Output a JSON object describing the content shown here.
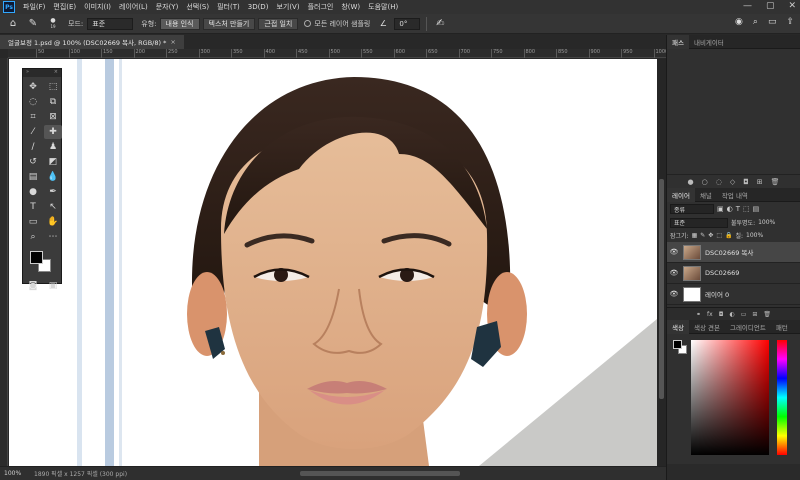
{
  "menubar": {
    "logo": "Ps",
    "items": [
      "파일(F)",
      "편집(E)",
      "이미지(I)",
      "레이어(L)",
      "문자(Y)",
      "선택(S)",
      "필터(T)",
      "3D(D)",
      "보기(V)",
      "플러그인",
      "창(W)",
      "도움말(H)"
    ],
    "window_controls": [
      "—",
      "▢",
      "✕"
    ]
  },
  "options": {
    "brush_size": "19",
    "mode_label": "모드:",
    "mode_value": "표준",
    "type_label": "유형:",
    "type_buttons": [
      "내용 인식",
      "텍스처 만들기",
      "근접 일치"
    ],
    "sample_all_layers": "모든 레이어 샘플링",
    "angle": "0°"
  },
  "document": {
    "tab_title": "얼굴보정 1.psd @ 100% (DSC02669 복사, RGB/8) *",
    "close": "×"
  },
  "ruler": {
    "ticks": [
      "50",
      "100",
      "150",
      "200",
      "250",
      "300",
      "350",
      "400",
      "450",
      "500",
      "550",
      "600",
      "650",
      "700",
      "750",
      "800",
      "850",
      "900",
      "950",
      "1000"
    ]
  },
  "status": {
    "zoom": "100%",
    "info": "1890 픽셀 x 1257 픽셀 (300 ppi)"
  },
  "panels": {
    "paths_tabs": [
      "패스",
      "내비게이터"
    ],
    "layers_tabs": [
      "레이어",
      "채널",
      "작업 내역"
    ],
    "filter_kind": "종류",
    "blend_mode": "표준",
    "opacity_label": "불투명도:",
    "opacity_value": "100%",
    "lock_label": "잠그기:",
    "fill_label": "칠:",
    "fill_value": "100%",
    "layers": [
      {
        "name": "DSC02669 복사",
        "selected": true
      },
      {
        "name": "DSC02669",
        "selected": false
      },
      {
        "name": "레이어 0",
        "selected": false
      }
    ],
    "color_tabs": [
      "색상",
      "색상 견본",
      "그레이디언트",
      "패턴"
    ]
  },
  "colors": {
    "accent": "#31a8ff",
    "foreground": "#000000",
    "background": "#ffffff"
  }
}
